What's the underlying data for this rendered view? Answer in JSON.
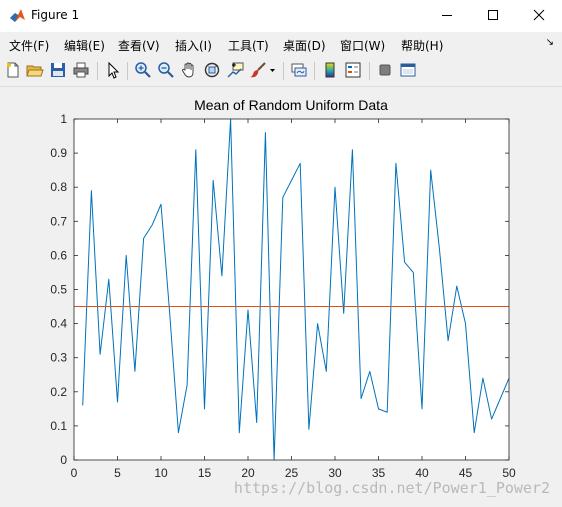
{
  "window": {
    "title": "Figure 1",
    "minimize_icon": "minimize-icon",
    "maximize_icon": "maximize-icon",
    "close_icon": "close-icon"
  },
  "menu": {
    "items": [
      "文件(F)",
      "编辑(E)",
      "查看(V)",
      "插入(I)",
      "工具(T)",
      "桌面(D)",
      "窗口(W)",
      "帮助(H)"
    ],
    "overflow_icon": "menu-overflow-arrow-icon"
  },
  "toolbar": {
    "icons": [
      "new-figure-icon",
      "open-file-icon",
      "save-figure-icon",
      "print-figure-icon",
      "edit-plot-arrow-icon",
      "zoom-in-icon",
      "zoom-out-icon",
      "pan-hand-icon",
      "rotate-3d-icon",
      "data-cursor-icon",
      "brush-icon",
      "brush-dropdown-icon",
      "link-plot-icon",
      "insert-colorbar-icon",
      "insert-legend-icon",
      "hide-plot-tools-icon",
      "show-plot-tools-icon"
    ]
  },
  "colors": {
    "series_primary": "#0072bd",
    "series_mean": "#d95319",
    "axes_background": "#ffffff",
    "figure_background": "#f0f0f0"
  },
  "chart_data": {
    "type": "line",
    "title": "Mean of Random Uniform Data",
    "xlabel": "",
    "ylabel": "",
    "xlim": [
      0,
      50
    ],
    "ylim": [
      0,
      1
    ],
    "xticks": [
      0,
      5,
      10,
      15,
      20,
      25,
      30,
      35,
      40,
      45,
      50
    ],
    "yticks": [
      0,
      0.1,
      0.2,
      0.3,
      0.4,
      0.5,
      0.6,
      0.7,
      0.8,
      0.9,
      1
    ],
    "grid": false,
    "legend": "none",
    "series": [
      {
        "x": [
          1,
          2,
          3,
          4,
          5,
          6,
          7,
          8,
          9,
          10,
          11,
          12,
          13,
          14,
          15,
          16,
          17,
          18,
          19,
          20,
          21,
          22,
          23,
          24,
          25,
          26,
          27,
          28,
          29,
          30,
          31,
          32,
          33,
          34,
          35,
          36,
          37,
          38,
          39,
          40,
          41,
          42,
          43,
          44,
          45,
          46,
          47,
          48,
          49,
          50
        ],
        "values": [
          0.16,
          0.79,
          0.31,
          0.53,
          0.17,
          0.6,
          0.26,
          0.65,
          0.69,
          0.75,
          0.43,
          0.08,
          0.22,
          0.91,
          0.15,
          0.82,
          0.54,
          1.0,
          0.08,
          0.44,
          0.11,
          0.96,
          0.0,
          0.77,
          0.82,
          0.87,
          0.09,
          0.4,
          0.26,
          0.8,
          0.43,
          0.91,
          0.18,
          0.26,
          0.15,
          0.14,
          0.87,
          0.58,
          0.55,
          0.15,
          0.85,
          0.62,
          0.35,
          0.51,
          0.4,
          0.08,
          0.24,
          0.12,
          0.18,
          0.24
        ]
      },
      {
        "x": [
          0,
          50
        ],
        "values": [
          0.45,
          0.45
        ]
      }
    ]
  },
  "watermark": "https://blog.csdn.net/Power1_Power2"
}
